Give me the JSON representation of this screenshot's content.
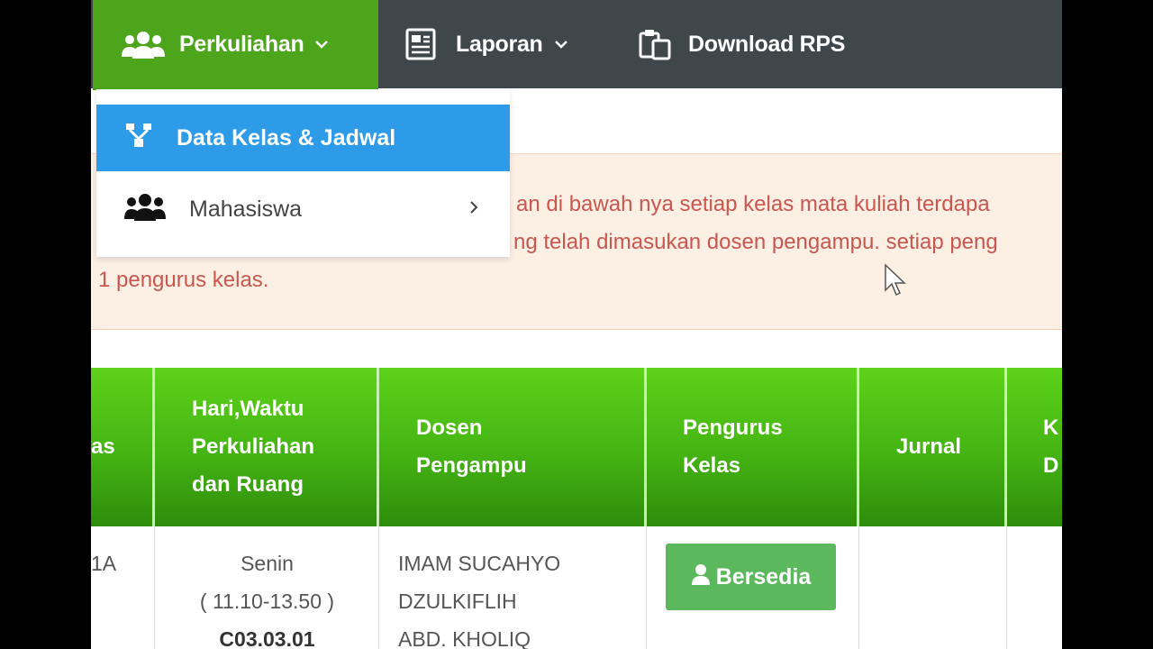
{
  "nav": {
    "perkuliahan": "Perkuliahan",
    "laporan": "Laporan",
    "download_rps": "Download RPS"
  },
  "dropdown": {
    "active_item": "Data Kelas & Jadwal",
    "mahasiswa": "Mahasiswa"
  },
  "alert": {
    "line1": "an di bawah nya setiap kelas mata kuliah terdapa",
    "line2": "ng telah dimasukan dosen pengampu. setiap peng",
    "line3": "1 pengurus kelas."
  },
  "table": {
    "headers": {
      "kelas_partial": "as",
      "hari_line1": "Hari,Waktu",
      "hari_line2": "Perkuliahan",
      "hari_line3": "dan Ruang",
      "dosen_line1": "Dosen",
      "dosen_line2": "Pengampu",
      "pengurus_line1": "Pengurus",
      "pengurus_line2": "Kelas",
      "jurnal": "Jurnal",
      "next_line1": "K",
      "next_line2": "D"
    },
    "row": {
      "kelas_partial": "1A",
      "hari": "Senin",
      "waktu": "( 11.10-13.50 )",
      "ruang": "C03.03.01",
      "dosen1": "IMAM SUCAHYO",
      "dosen2": "DZULKIFLIH",
      "dosen3": "ABD. KHOLIQ",
      "button": "Bersedia"
    }
  },
  "colors": {
    "nav_bg": "#3f474b",
    "nav_active": "#4ca51b",
    "dropdown_active": "#2e9be8",
    "alert_bg": "#fcefe4",
    "alert_text": "#c9564f",
    "header_green": "#44b313",
    "button_green": "#5cb85c"
  }
}
